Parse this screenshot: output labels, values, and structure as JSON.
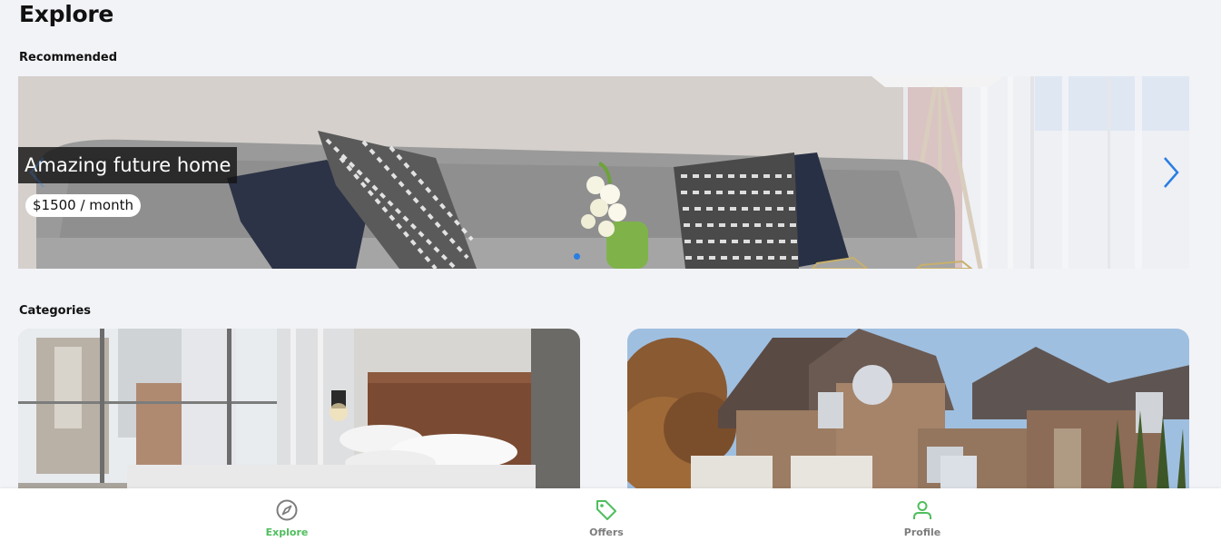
{
  "page": {
    "title": "Explore"
  },
  "recommended": {
    "section_title": "Recommended",
    "slides": [
      {
        "title": "Amazing future home",
        "price": "$1500 / month"
      }
    ],
    "active_slide": 0,
    "dot_count": 1
  },
  "categories": {
    "section_title": "Categories",
    "items": [
      {
        "image": "apartment-bedroom"
      },
      {
        "image": "suburban-house"
      }
    ]
  },
  "bottom_nav": {
    "items": [
      {
        "label": "Explore",
        "icon": "compass-icon",
        "active": true
      },
      {
        "label": "Offers",
        "icon": "tag-icon",
        "active": false
      },
      {
        "label": "Profile",
        "icon": "user-icon",
        "active": false
      }
    ]
  },
  "colors": {
    "background": "#f2f3f7",
    "accent_green": "#4fbe5d",
    "arrow_blue": "#2a7de1",
    "inactive_label": "#7d7d7d"
  }
}
